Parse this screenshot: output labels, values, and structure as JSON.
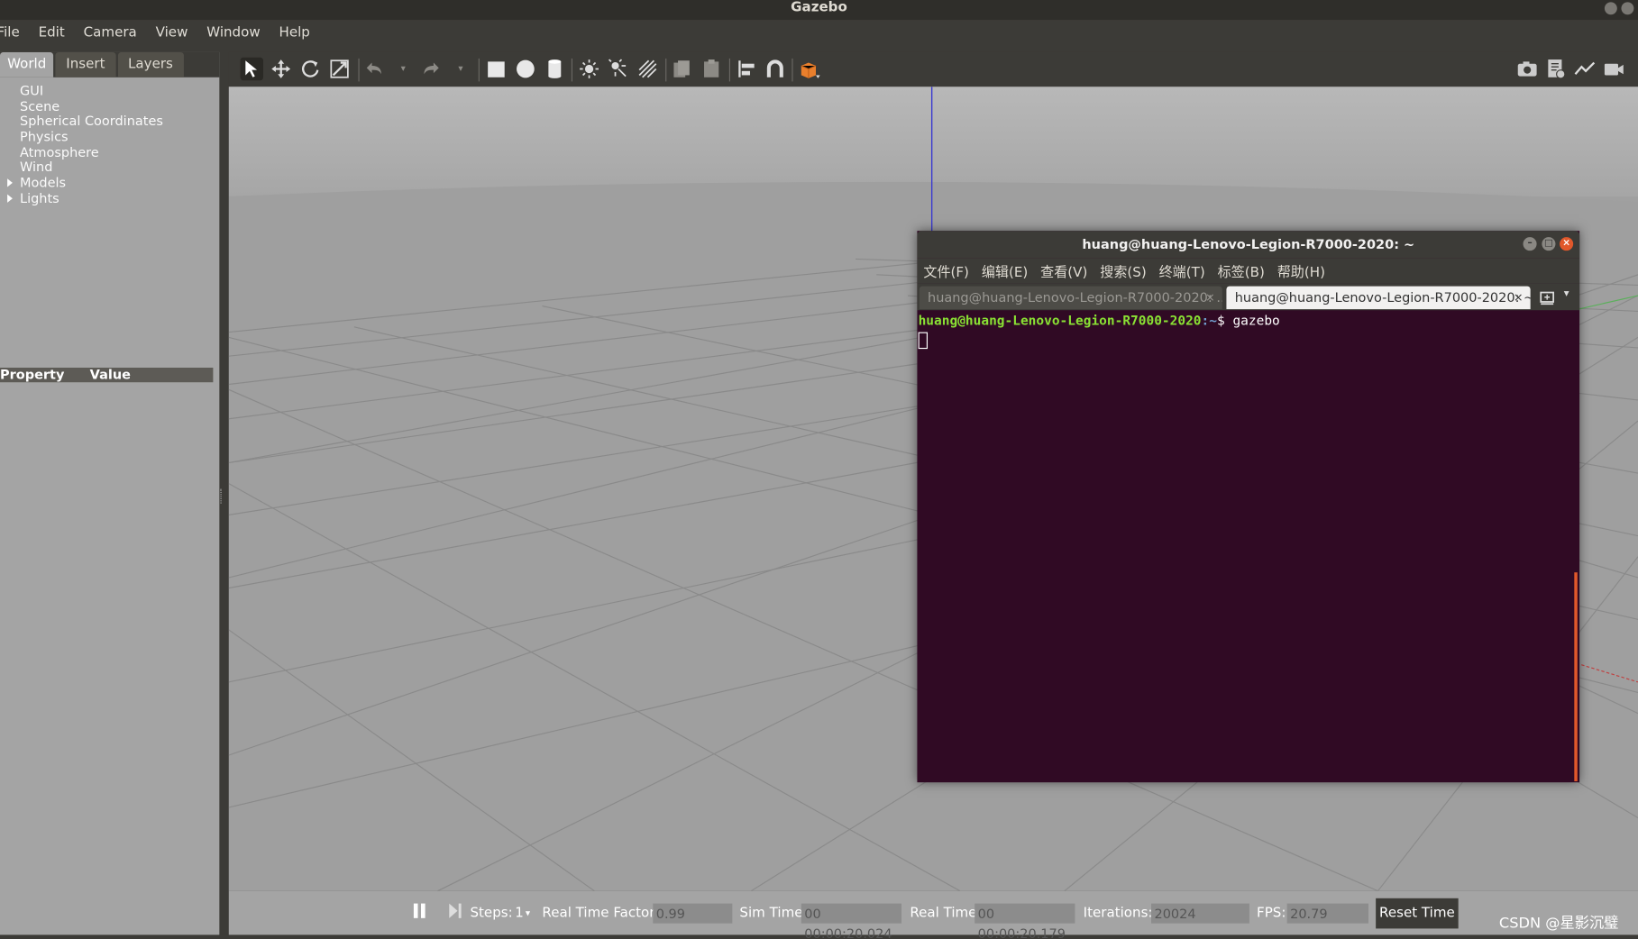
{
  "window": {
    "title": "Gazebo"
  },
  "menubar": [
    "File",
    "Edit",
    "Camera",
    "View",
    "Window",
    "Help"
  ],
  "left_panel": {
    "tabs": [
      "World",
      "Insert",
      "Layers"
    ],
    "tree": [
      {
        "label": "GUI",
        "expandable": false
      },
      {
        "label": "Scene",
        "expandable": false
      },
      {
        "label": "Spherical Coordinates",
        "expandable": false
      },
      {
        "label": "Physics",
        "expandable": false
      },
      {
        "label": "Atmosphere",
        "expandable": false
      },
      {
        "label": "Wind",
        "expandable": false
      },
      {
        "label": "Models",
        "expandable": true
      },
      {
        "label": "Lights",
        "expandable": true
      }
    ],
    "property_header": {
      "property": "Property",
      "value": "Value"
    }
  },
  "toolbar": {
    "icons": [
      "select-arrow-icon",
      "translate-icon",
      "rotate-icon",
      "scale-icon",
      "undo-icon",
      "redo-icon",
      "box-icon",
      "sphere-icon",
      "cylinder-icon",
      "point-light-icon",
      "spot-light-icon",
      "directional-light-icon",
      "copy-icon",
      "paste-icon",
      "align-icon",
      "snap-icon",
      "view-angle-icon",
      "screenshot-icon",
      "log-icon",
      "plot-icon",
      "video-icon"
    ]
  },
  "bottom_bar": {
    "steps_label": "Steps:",
    "steps_value": "1",
    "rtf_label": "Real Time Factor:",
    "rtf_value": "0.99",
    "sim_time_label": "Sim Time:",
    "sim_time_value": "00 00:00:20.024",
    "real_time_label": "Real Time:",
    "real_time_value": "00 00:00:20.179",
    "iterations_label": "Iterations:",
    "iterations_value": "20024",
    "fps_label": "FPS:",
    "fps_value": "20.79",
    "reset_label": "Reset Time"
  },
  "watermark": "CSDN @星影沉璧",
  "terminal": {
    "title": "huang@huang-Lenovo-Legion-R7000-2020: ~",
    "menu": [
      "文件(F)",
      "编辑(E)",
      "查看(V)",
      "搜索(S)",
      "终端(T)",
      "标签(B)",
      "帮助(H)"
    ],
    "tabs": [
      {
        "label": "huang@huang-Lenovo-Legion-R7000-2020: ...",
        "active": false
      },
      {
        "label": "huang@huang-Lenovo-Legion-R7000-2020: ~",
        "active": true
      }
    ],
    "prompt_user": "huang@huang-Lenovo-Legion-R7000-2020",
    "prompt_path": ":~",
    "prompt_command": "$ gazebo"
  }
}
